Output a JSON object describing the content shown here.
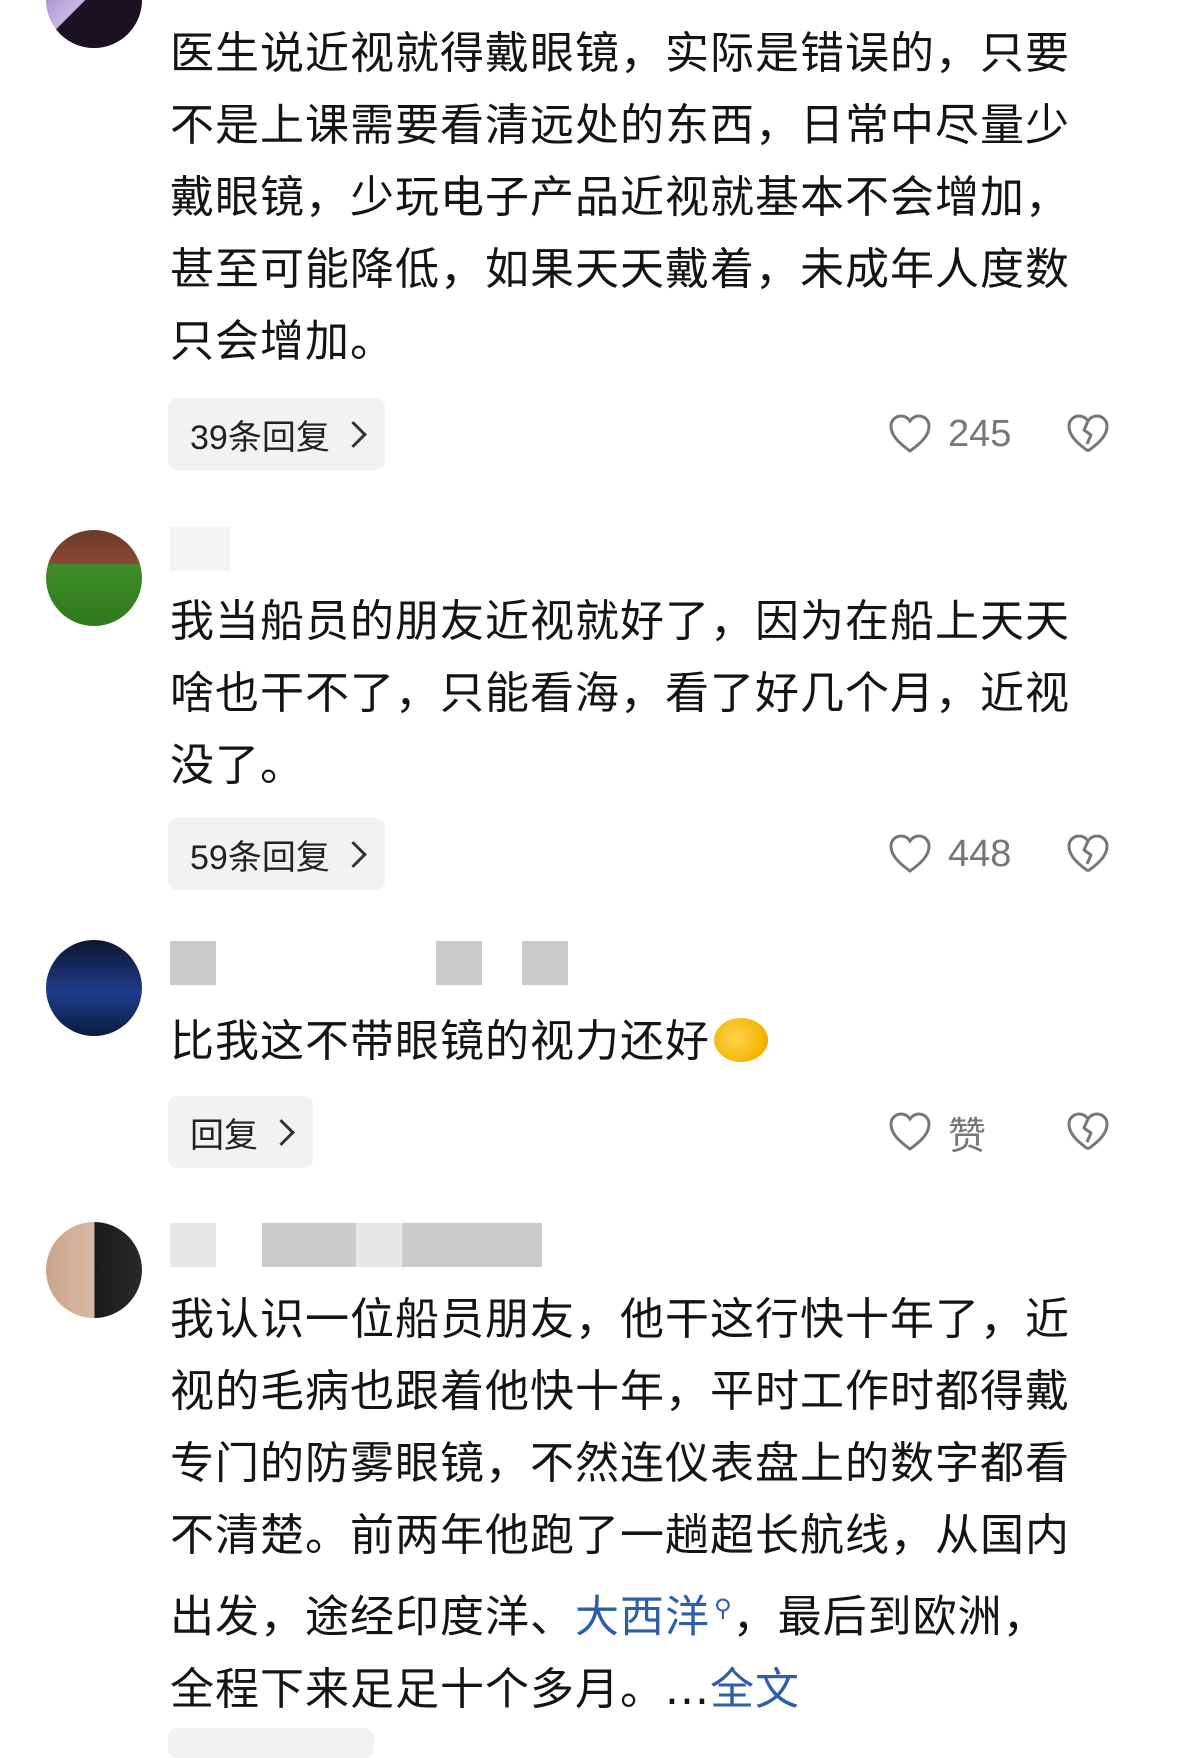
{
  "comments": [
    {
      "text": "医生说近视就得戴眼镜，实际是错误的，只要不是上课需要看清远处的东西，日常中尽量少戴眼镜，少玩电子产品近视就基本不会增加，甚至可能降低，如果天天戴着，未成年人度数只会增加。",
      "reply_label": "39条回复",
      "likes": "245"
    },
    {
      "text": "我当船员的朋友近视就好了，因为在船上天天啥也干不了，只能看海，看了好几个月，近视没了。",
      "reply_label": "59条回复",
      "likes": "448"
    },
    {
      "text": "比我这不带眼镜的视力还好",
      "emoji": "face-with-hand-over-mouth",
      "reply_label": "回复",
      "likes": "赞"
    },
    {
      "text_before_link": "我认识一位船员朋友，他干这行快十年了，近视的毛病也跟着他快十年，平时工作时都得戴专门的防雾眼镜，不然连仪表盘上的数字都看不清楚。前两年他跑了一趟超长航线，从国内出发，途经印度洋、",
      "link": "大西洋",
      "text_after_link": "，最后到欧洲，全程下来足足十个多月。...",
      "expand_label": "全文"
    }
  ],
  "colors": {
    "link": "#2f5ea8",
    "muted": "#777777",
    "chip_bg": "#f2f2f2"
  }
}
